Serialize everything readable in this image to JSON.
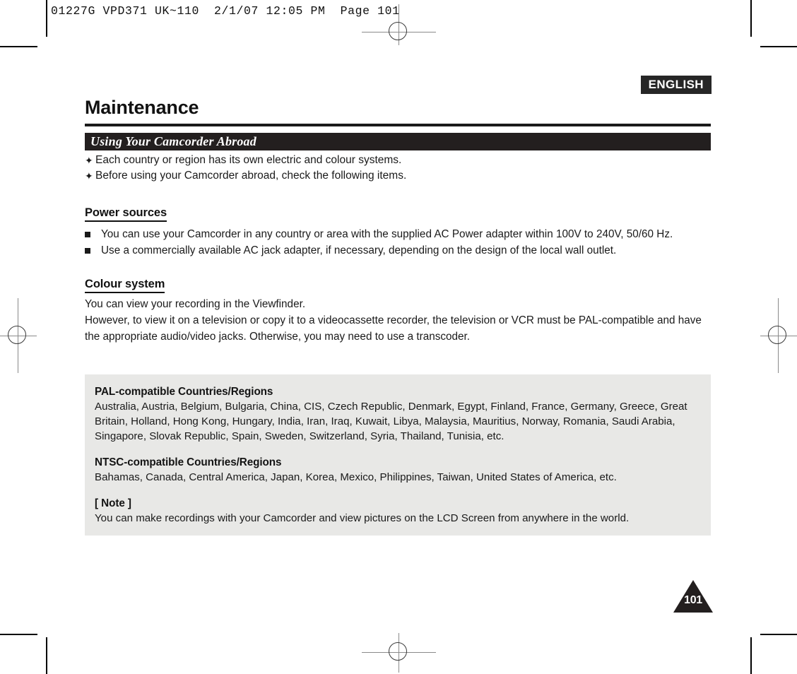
{
  "film_header": "01227G VPD371 UK~110  2/1/07 12:05 PM  Page 101",
  "language_tab": "ENGLISH",
  "chapter_title": "Maintenance",
  "section_bar_title": "Using Your Camcorder Abroad",
  "intro_bullets": [
    "Each country or region has its own electric and colour systems.",
    "Before using your Camcorder abroad, check the following items."
  ],
  "power_sources": {
    "heading": "Power sources",
    "items": [
      "You can use your Camcorder in any country or area with the supplied AC Power adapter within 100V to 240V, 50/60 Hz.",
      "Use a commercially available AC jack adapter, if necessary, depending on the design of the local wall outlet."
    ]
  },
  "colour_system": {
    "heading": "Colour system",
    "paragraphs": [
      "You can view your recording in the Viewfinder.",
      "However, to view it on a television or copy it to a videocassette recorder, the television or VCR must be PAL-compatible and have the appropriate audio/video jacks. Otherwise, you may need to use a transcoder."
    ]
  },
  "info_panel": {
    "pal_heading": "PAL-compatible Countries/Regions",
    "pal_list": "Australia, Austria, Belgium, Bulgaria, China, CIS, Czech Republic, Denmark, Egypt, Finland, France, Germany, Greece, Great Britain, Holland, Hong Kong, Hungary, India, Iran, Iraq, Kuwait, Libya, Malaysia, Mauritius, Norway, Romania, Saudi Arabia, Singapore, Slovak Republic, Spain, Sweden, Switzerland, Syria, Thailand, Tunisia, etc.",
    "ntsc_heading": "NTSC-compatible Countries/Regions",
    "ntsc_list": "Bahamas, Canada, Central America, Japan, Korea, Mexico, Philippines, Taiwan, United States of America, etc.",
    "note_heading": "[ Note ]",
    "note_text": "You can make recordings with your Camcorder and view pictures on the LCD Screen from anywhere in the world."
  },
  "page_number": "101",
  "bullet_glyph": "✦",
  "colors": {
    "bar_dark": "#231f1f",
    "panel_grey": "#e8e8e6",
    "text": "#1a1a1a"
  }
}
